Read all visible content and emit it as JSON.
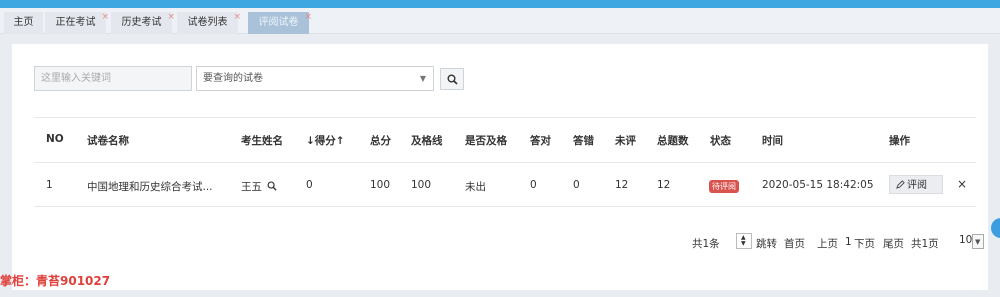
{
  "tabs": [
    {
      "label": "主页",
      "closable": false,
      "active": false
    },
    {
      "label": "正在考试",
      "closable": true,
      "active": false
    },
    {
      "label": "历史考试",
      "closable": true,
      "active": false
    },
    {
      "label": "试卷列表",
      "closable": true,
      "active": false
    },
    {
      "label": "评阅试卷",
      "closable": true,
      "active": true
    }
  ],
  "tab_close_glyph": "×",
  "search": {
    "keyword_placeholder": "这里输入关键词",
    "paper_select_value": "要查询的试卷",
    "caret_glyph": "▼",
    "search_icon": "search-icon"
  },
  "table": {
    "headers": {
      "no": "NO",
      "name": "试卷名称",
      "student": "考生姓名",
      "score": "↓得分↑",
      "total": "总分",
      "pass_line": "及格线",
      "passed": "是否及格",
      "correct": "答对",
      "wrong": "答错",
      "unreviewed": "未评",
      "question_count": "总题数",
      "status": "状态",
      "time": "时间",
      "actions": "操作"
    },
    "rows": [
      {
        "no": "1",
        "name": "中国地理和历史综合考试...",
        "student": "王五",
        "score": "0",
        "total": "100",
        "pass_line": "100",
        "passed": "未出",
        "correct": "0",
        "wrong": "0",
        "unreviewed": "12",
        "question_count": "12",
        "status": "待评阅",
        "time": "2020-05-15 18:42:05",
        "review_label": "评阅",
        "close_glyph": "×"
      }
    ]
  },
  "pagination": {
    "total": "共1条",
    "jump": "跳转",
    "first": "首页",
    "prev": "上页",
    "current": "1",
    "next": "下页",
    "last": "尾页",
    "pages": "共1页",
    "page_size": "10"
  },
  "watermark": "掌柜：青苔901027",
  "colors": {
    "accent": "#3ea6e0",
    "status_badge": "#d9534f",
    "watermark": "#e0403a"
  }
}
